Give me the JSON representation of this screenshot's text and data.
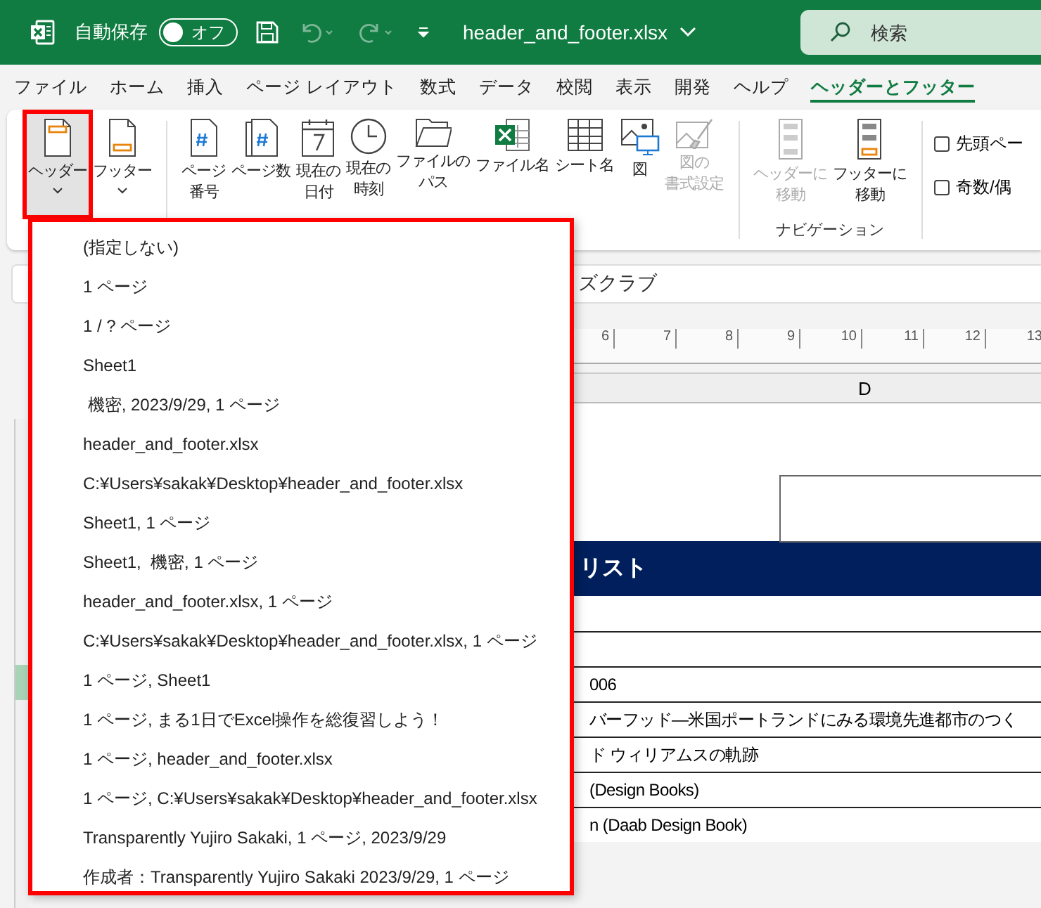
{
  "title_bar": {
    "autosave_label": "自動保存",
    "autosave_toggle": {
      "label": "オフ",
      "on": false
    },
    "file_name": "header_and_footer.xlsx",
    "search": {
      "placeholder": "検索"
    }
  },
  "menu_tabs": [
    {
      "label": "ファイル",
      "selected": false
    },
    {
      "label": "ホーム",
      "selected": false
    },
    {
      "label": "挿入",
      "selected": false
    },
    {
      "label": "ページ レイアウト",
      "selected": false
    },
    {
      "label": "数式",
      "selected": false
    },
    {
      "label": "データ",
      "selected": false
    },
    {
      "label": "校閲",
      "selected": false
    },
    {
      "label": "表示",
      "selected": false
    },
    {
      "label": "開発",
      "selected": false
    },
    {
      "label": "ヘルプ",
      "selected": false
    },
    {
      "label": "ヘッダーとフッター",
      "selected": true
    }
  ],
  "ribbon": {
    "groups": [
      {
        "buttons": [
          {
            "kind": "header",
            "label": "ヘッダー",
            "dropdown": true,
            "disabled": false,
            "selected": true
          },
          {
            "kind": "footer",
            "label": "フッター",
            "dropdown": true,
            "disabled": false,
            "selected": false
          }
        ]
      },
      {
        "buttons": [
          {
            "kind": "page-number",
            "label": [
              "ページ",
              "番号"
            ],
            "dropdown": false,
            "disabled": false,
            "selected": false
          },
          {
            "kind": "page-count",
            "label": "ページ数",
            "dropdown": false,
            "disabled": false,
            "selected": false
          },
          {
            "kind": "date",
            "label": [
              "現在の",
              "日付"
            ],
            "dropdown": false,
            "disabled": false,
            "selected": false
          },
          {
            "kind": "time",
            "label": [
              "現在の",
              "時刻"
            ],
            "dropdown": false,
            "disabled": false,
            "selected": false
          },
          {
            "kind": "path",
            "label": [
              "ファイルの",
              "パス"
            ],
            "dropdown": false,
            "disabled": false,
            "selected": false
          },
          {
            "kind": "file-name",
            "label": "ファイル名",
            "dropdown": false,
            "disabled": false,
            "selected": false
          },
          {
            "kind": "sheet-name",
            "label": "シート名",
            "dropdown": false,
            "disabled": false,
            "selected": false
          },
          {
            "kind": "picture",
            "label": "図",
            "dropdown": false,
            "disabled": false,
            "selected": false
          },
          {
            "kind": "format-picture",
            "label": [
              "図の",
              "書式設定"
            ],
            "dropdown": false,
            "disabled": true,
            "selected": false
          }
        ]
      },
      {
        "label": "ナビゲーション",
        "buttons": [
          {
            "kind": "goto-header",
            "label": [
              "ヘッダーに",
              "移動"
            ],
            "dropdown": false,
            "disabled": true,
            "selected": false
          },
          {
            "kind": "goto-footer",
            "label": [
              "フッターに",
              "移動"
            ],
            "dropdown": false,
            "disabled": false,
            "selected": false
          }
        ]
      }
    ],
    "checkboxes": [
      {
        "label": "先頭ペー",
        "checked": false
      },
      {
        "label": "奇数/偶",
        "checked": false
      }
    ]
  },
  "formula_bar": {
    "value": "ズクラブ"
  },
  "ruler": {
    "ticks": [
      "6",
      "7",
      "8",
      "9",
      "10",
      "11",
      "12",
      "13"
    ]
  },
  "column_header": "D",
  "sheet": {
    "title": "リスト",
    "rows": [
      {
        "text": "",
        "selected": false
      },
      {
        "text": "006",
        "selected": true
      },
      {
        "text": "バーフッド—米国ポートランドにみる環境先進都市のつく",
        "selected": false
      },
      {
        "text": "ド ウィリアムスの軌跡",
        "selected": false
      },
      {
        "text": "(Design Books)",
        "selected": false
      },
      {
        "text": "n (Daab Design Book)",
        "selected": false
      }
    ]
  },
  "header_dropdown": {
    "items": [
      "(指定しない)",
      "1 ページ",
      "1 / ? ページ",
      "Sheet1",
      " 機密, 2023/9/29, 1 ページ",
      "header_and_footer.xlsx",
      "C:¥Users¥sakak¥Desktop¥header_and_footer.xlsx",
      "Sheet1, 1 ページ",
      "Sheet1,  機密, 1 ページ",
      "header_and_footer.xlsx, 1 ページ",
      "C:¥Users¥sakak¥Desktop¥header_and_footer.xlsx, 1 ページ",
      "1 ページ, Sheet1",
      "1 ページ, まる1日でExcel操作を総復習しよう！",
      "1 ページ, header_and_footer.xlsx",
      "1 ページ, C:¥Users¥sakak¥Desktop¥header_and_footer.xlsx",
      "Transparently Yujiro Sakaki, 1 ページ, 2023/9/29",
      "作成者：Transparently Yujiro Sakaki 2023/9/29, 1 ページ"
    ]
  }
}
